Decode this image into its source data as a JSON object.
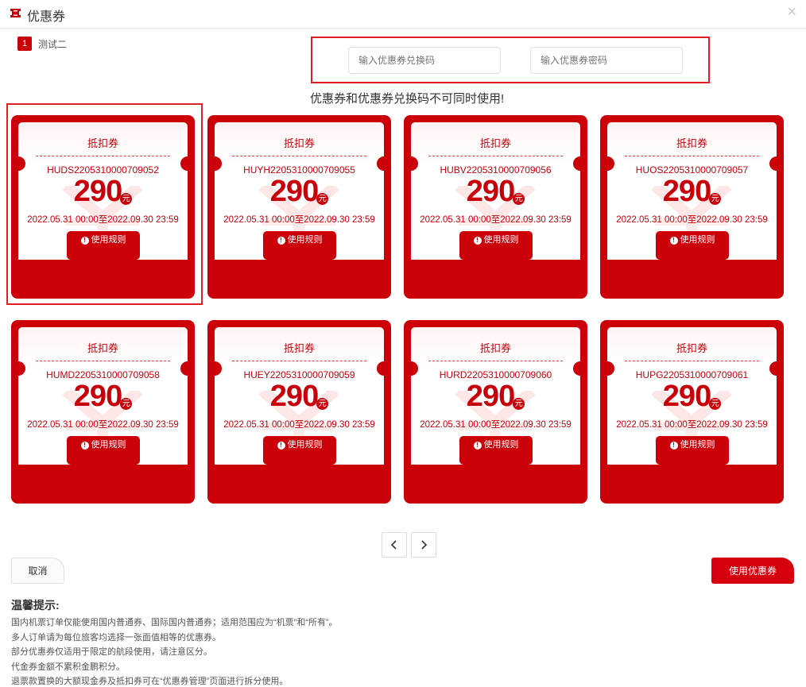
{
  "dialog": {
    "title": "优惠券",
    "close_label": "×"
  },
  "passenger": {
    "index": "1",
    "name": "测试二"
  },
  "code_inputs": {
    "coupon_code_placeholder": "输入优惠券兑换码",
    "coupon_password_placeholder": "输入优惠券密码"
  },
  "notice": "优惠券和优惠券兑换码不可同时使用!",
  "coupons": [
    {
      "type": "抵扣券",
      "code": "HUDS2205310000709052",
      "amount": "290",
      "unit": "元",
      "validity": "2022.05.31 00:00至2022.09.30 23:59",
      "rule_label": "使用规则",
      "selected": true
    },
    {
      "type": "抵扣券",
      "code": "HUYH2205310000709055",
      "amount": "290",
      "unit": "元",
      "validity": "2022.05.31 00:00至2022.09.30 23:59",
      "rule_label": "使用规则",
      "selected": false
    },
    {
      "type": "抵扣券",
      "code": "HUBV2205310000709056",
      "amount": "290",
      "unit": "元",
      "validity": "2022.05.31 00:00至2022.09.30 23:59",
      "rule_label": "使用规则",
      "selected": false
    },
    {
      "type": "抵扣券",
      "code": "HUOS2205310000709057",
      "amount": "290",
      "unit": "元",
      "validity": "2022.05.31 00:00至2022.09.30 23:59",
      "rule_label": "使用规则",
      "selected": false
    },
    {
      "type": "抵扣券",
      "code": "HUMD2205310000709058",
      "amount": "290",
      "unit": "元",
      "validity": "2022.05.31 00:00至2022.09.30 23:59",
      "rule_label": "使用规则",
      "selected": false
    },
    {
      "type": "抵扣券",
      "code": "HUEY2205310000709059",
      "amount": "290",
      "unit": "元",
      "validity": "2022.05.31 00:00至2022.09.30 23:59",
      "rule_label": "使用规则",
      "selected": false
    },
    {
      "type": "抵扣券",
      "code": "HURD2205310000709060",
      "amount": "290",
      "unit": "元",
      "validity": "2022.05.31 00:00至2022.09.30 23:59",
      "rule_label": "使用规则",
      "selected": false
    },
    {
      "type": "抵扣券",
      "code": "HUPG2205310000709061",
      "amount": "290",
      "unit": "元",
      "validity": "2022.05.31 00:00至2022.09.30 23:59",
      "rule_label": "使用规则",
      "selected": false
    }
  ],
  "icons": {
    "header": "ticket-icon",
    "close": "close-icon",
    "rule": "info-icon",
    "prev": "chevron-left-icon",
    "next": "chevron-right-icon"
  },
  "actions": {
    "cancel_label": "取消",
    "use_label": "使用优惠券"
  },
  "tips": {
    "title": "温馨提示:",
    "items": [
      "国内机票订单仅能使用国内普通券、国际国内普通券；适用范围应为“机票”和“所有”。",
      "多人订单请为每位旅客均选择一张面值相等的优惠券。",
      "部分优惠券仅适用于限定的航段使用，请注意区分。",
      "代金券金额不累积金鹏积分。",
      "退票款置换的大额现金券及抵扣券可在“优惠券管理”页面进行拆分使用。"
    ]
  },
  "colors": {
    "brand_red": "#cc0008",
    "highlight_red": "#e02020",
    "card_inner_bg": "#ffffff"
  }
}
